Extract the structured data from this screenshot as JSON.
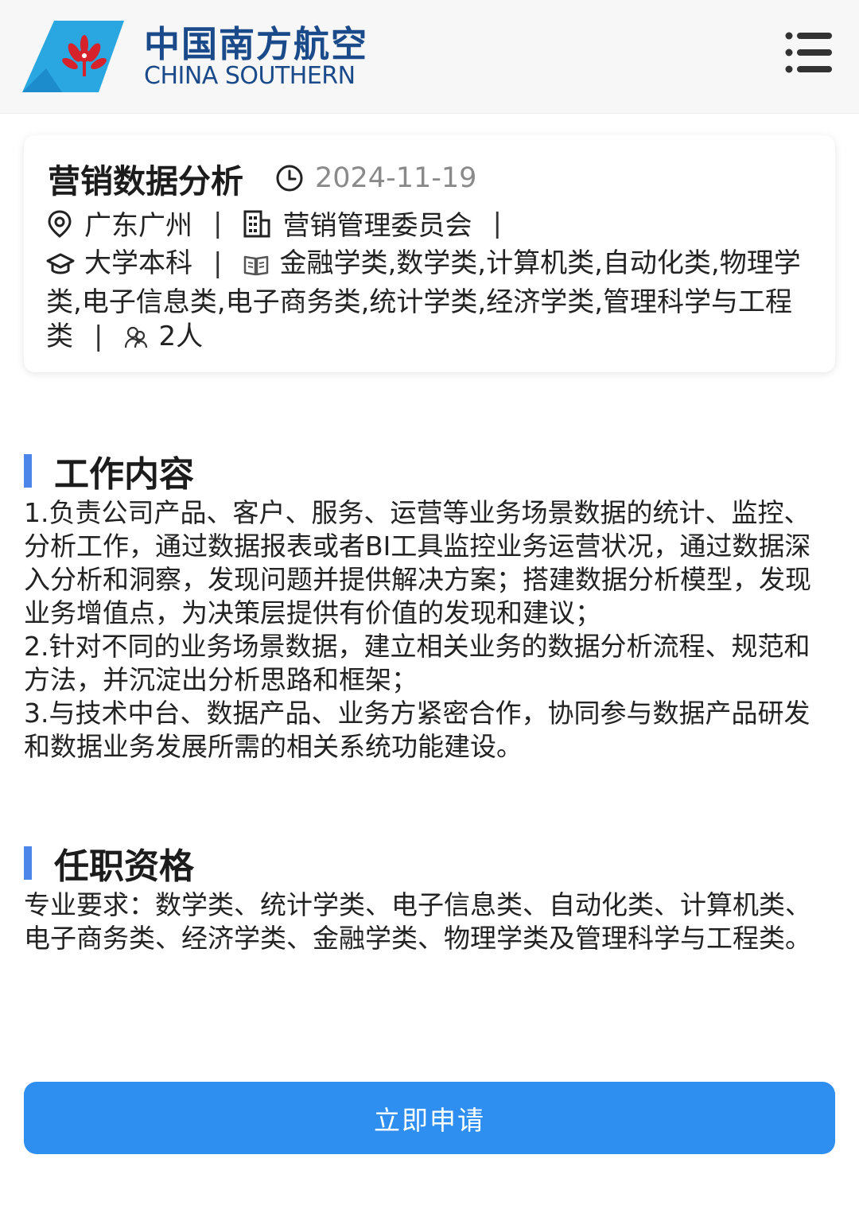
{
  "brand": {
    "name_cn": "中国南方航空",
    "name_en": "CHINA SOUTHERN"
  },
  "colors": {
    "accent": "#4c86e8",
    "button": "#2f8ff0",
    "logo_blue": "#2aa6e0",
    "logo_red": "#d6222a",
    "brand_text": "#1a4a8a"
  },
  "job": {
    "title": "营销数据分析",
    "date": "2024-11-19",
    "location": "广东广州",
    "department": "营销管理委员会",
    "education": "大学本科",
    "majors": "金融学类,数学类,计算机类,自动化类,物理学类,电子信息类,电子商务类,统计学类,经济学类,管理科学与工程类",
    "headcount": "2人",
    "separator": "|"
  },
  "sections": {
    "duties_title": "工作内容",
    "duties_text": "1.负责公司产品、客户、服务、运营等业务场景数据的统计、监控、分析工作，通过数据报表或者BI工具监控业务运营状况，通过数据深入分析和洞察，发现问题并提供解决方案；搭建数据分析模型，发现业务增值点，为决策层提供有价值的发现和建议；\n2.针对不同的业务场景数据，建立相关业务的数据分析流程、规范和方法，并沉淀出分析思路和框架；\n3.与技术中台、数据产品、业务方紧密合作，协同参与数据产品研发和数据业务发展所需的相关系统功能建设。",
    "qualifications_title": "任职资格",
    "qualifications_text": "专业要求：数学类、统计学类、电子信息类、自动化类、计算机类、电子商务类、经济学类、金融学类、物理学类及管理科学与工程类。"
  },
  "actions": {
    "apply_label": "立即申请"
  },
  "icons": {
    "logo": "kapok-flower-logo",
    "menu": "menu-icon",
    "date": "clock-icon",
    "location": "location-pin-icon",
    "department": "building-icon",
    "education": "graduation-cap-icon",
    "majors": "book-icon",
    "headcount": "people-icon"
  }
}
